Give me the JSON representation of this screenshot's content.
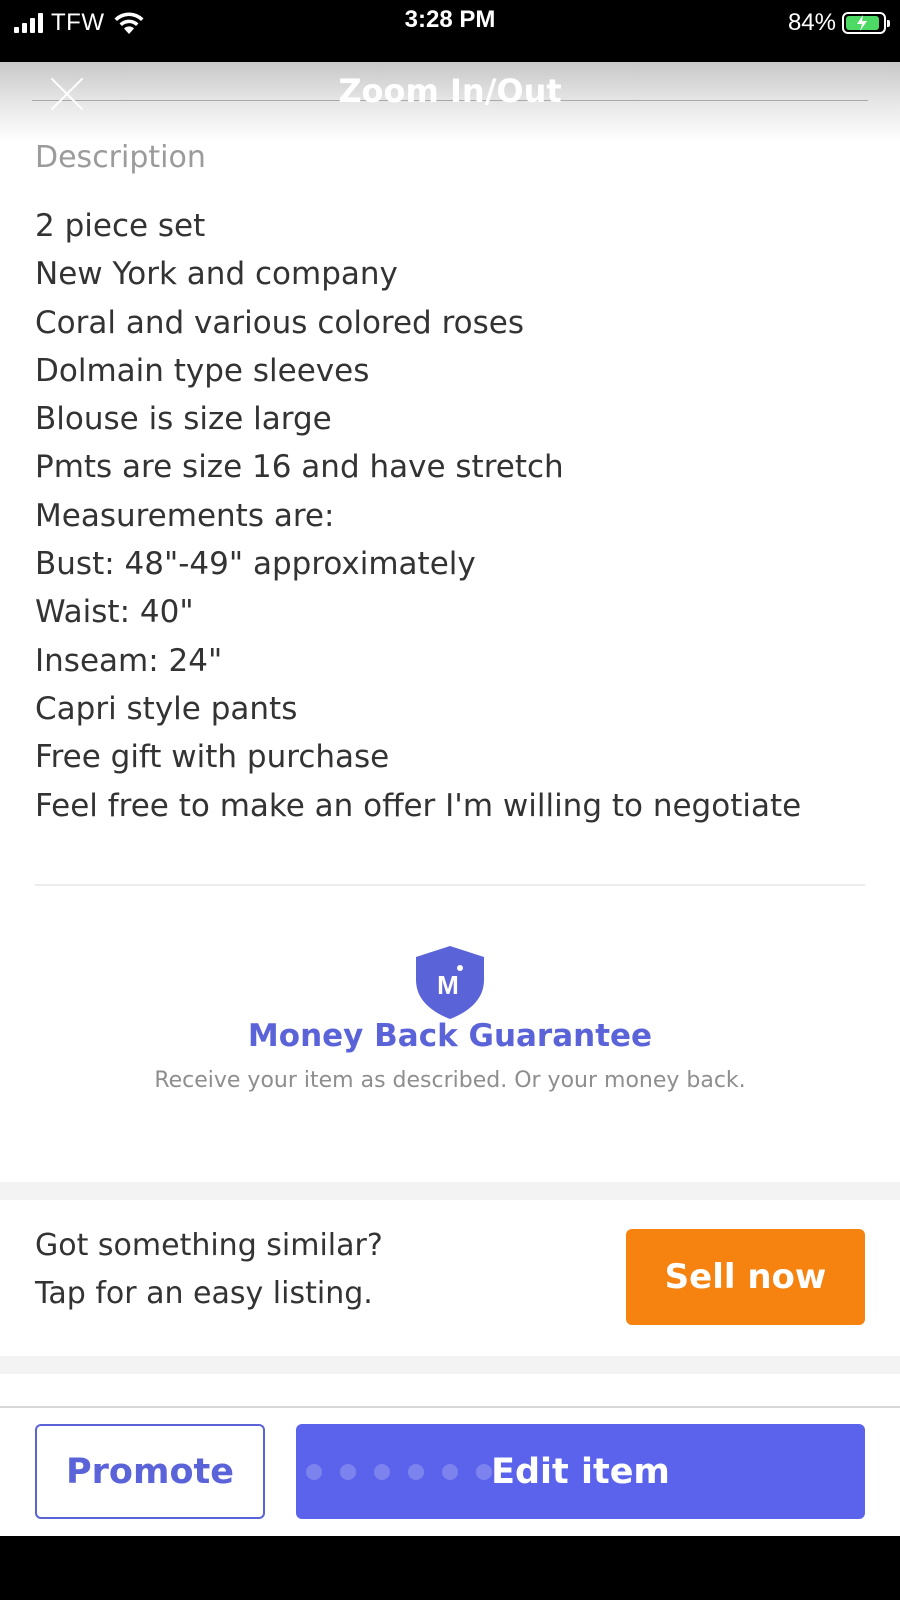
{
  "status_bar": {
    "carrier": "TFW",
    "time": "3:28 PM",
    "battery_percent": "84%",
    "battery_color": "#4cd964"
  },
  "header": {
    "title": "Zoom In/Out",
    "close_icon": "close-icon"
  },
  "description": {
    "label": "Description",
    "lines": [
      "2 piece set",
      "New York and company",
      "Coral and various colored roses",
      "Dolmain type sleeves",
      "Blouse is size large",
      "Pmts are size 16 and have stretch",
      "Measurements are:",
      "Bust: 48\"-49\" approximately",
      "Waist: 40\"",
      "Inseam: 24\"",
      "Capri style pants",
      "Free gift with purchase",
      "Feel free to make an offer I'm willing to negotiate"
    ]
  },
  "guarantee": {
    "icon": "shield-icon",
    "badge_letter": "M",
    "title": "Money Back Guarantee",
    "subtitle": "Receive your item as described. Or your money back.",
    "color": "#5b63d8"
  },
  "sell_prompt": {
    "line1": "Got something similar?",
    "line2": "Tap for an easy listing.",
    "button_label": "Sell now",
    "button_color": "#f6830f"
  },
  "actions": {
    "promote_label": "Promote",
    "edit_label": "Edit item",
    "accent_color": "#5b63ec"
  }
}
